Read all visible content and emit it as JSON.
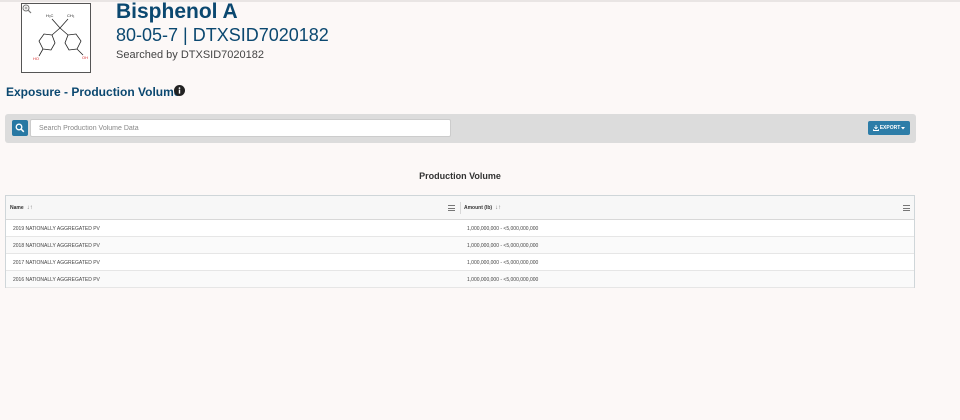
{
  "chemical": {
    "name": "Bisphenol A",
    "ids": "80-05-7 | DTXSID7020182",
    "searched_by": "Searched by DTXSID7020182",
    "structure_labels": {
      "h3c": "H₃C",
      "ch3": "CH₃",
      "oh_left": "HO",
      "oh_right": "OH"
    }
  },
  "section": {
    "title": "Exposure - Production Volume"
  },
  "toolbar": {
    "search_placeholder": "Search Production Volume Data",
    "export_label": "EXPORT"
  },
  "table": {
    "title": "Production Volume",
    "columns": [
      "Name",
      "Amount (lb)"
    ],
    "sort_glyph": "↓↑",
    "rows": [
      [
        "2019 NATIONALLY AGGREGATED PV",
        "1,000,000,000 - <5,000,000,000"
      ],
      [
        "2018 NATIONALLY AGGREGATED PV",
        "1,000,000,000 - <5,000,000,000"
      ],
      [
        "2017 NATIONALLY AGGREGATED PV",
        "1,000,000,000 - <5,000,000,000"
      ],
      [
        "2016 NATIONALLY AGGREGATED PV",
        "1,000,000,000 - <5,000,000,000"
      ]
    ]
  },
  "colors": {
    "brand_navy": "#0b4870",
    "accent_blue": "#2d7da8",
    "heteroatom_red": "#d93030"
  },
  "icons": [
    "zoom-in-icon",
    "info-icon",
    "search-icon",
    "download-icon",
    "caret-down-icon",
    "column-menu-icon"
  ]
}
